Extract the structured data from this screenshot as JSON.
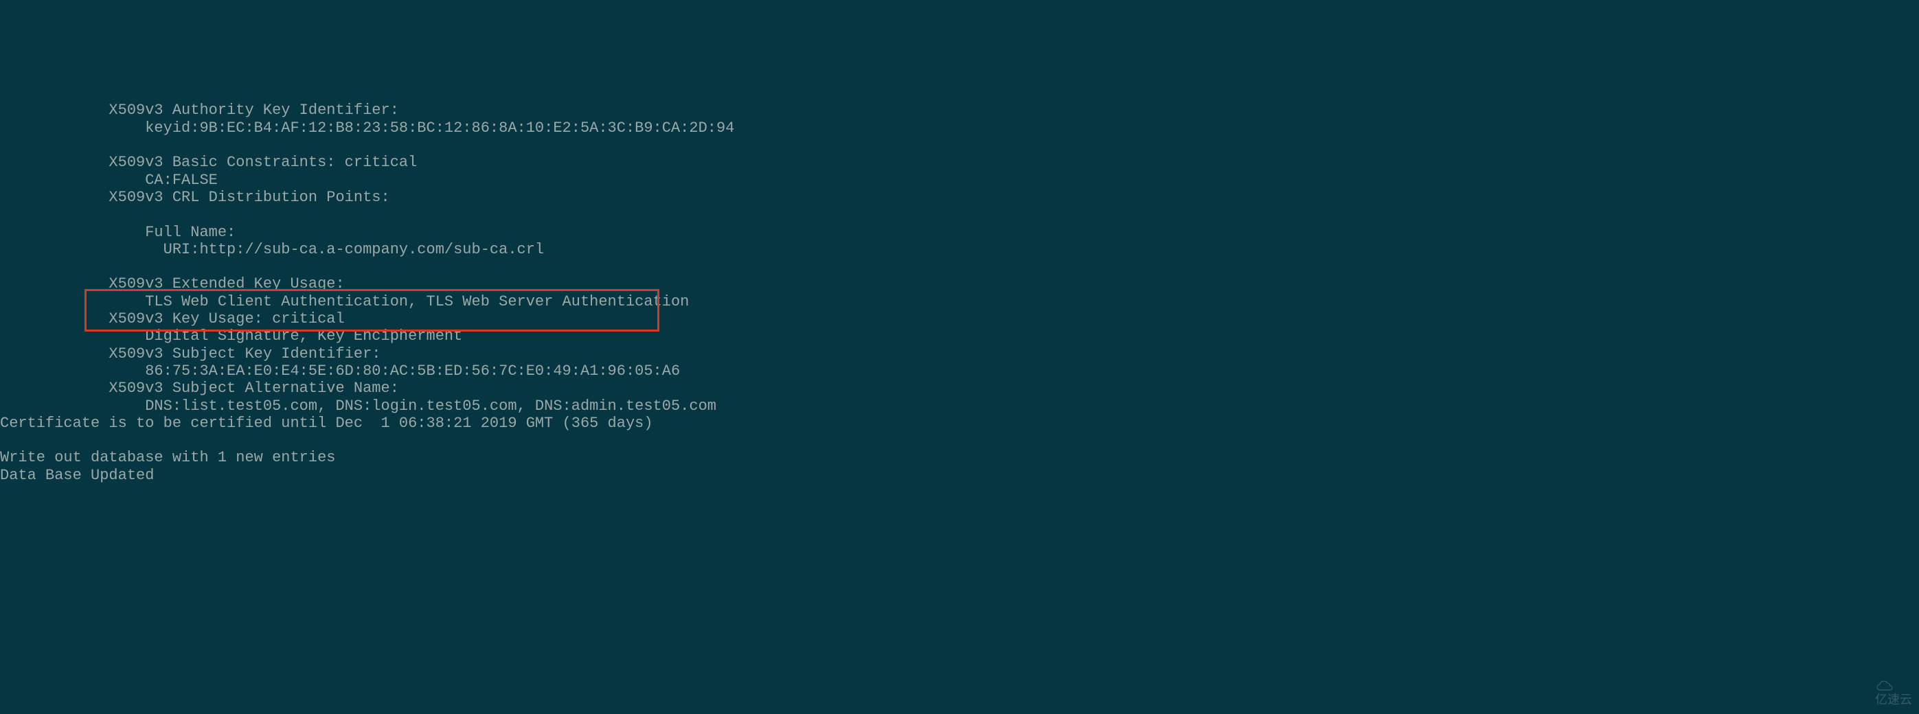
{
  "lines": {
    "l1": "            X509v3 Authority Key Identifier: ",
    "l2": "                keyid:9B:EC:B4:AF:12:B8:23:58:BC:12:86:8A:10:E2:5A:3C:B9:CA:2D:94",
    "l3": "",
    "l4": "            X509v3 Basic Constraints: critical",
    "l5": "                CA:FALSE",
    "l6": "            X509v3 CRL Distribution Points: ",
    "l7": "",
    "l8": "                Full Name:",
    "l9": "                  URI:http://sub-ca.a-company.com/sub-ca.crl",
    "l10": "",
    "l11": "            X509v3 Extended Key Usage: ",
    "l12": "                TLS Web Client Authentication, TLS Web Server Authentication",
    "l13": "            X509v3 Key Usage: critical",
    "l14": "                Digital Signature, Key Encipherment",
    "l15": "            X509v3 Subject Key Identifier: ",
    "l16": "                86:75:3A:EA:E0:E4:5E:6D:80:AC:5B:ED:56:7C:E0:49:A1:96:05:A6",
    "l17": "            X509v3 Subject Alternative Name: ",
    "l18": "                DNS:list.test05.com, DNS:login.test05.com, DNS:admin.test05.com",
    "l19": "Certificate is to be certified until Dec  1 06:38:21 2019 GMT (365 days)",
    "l20": "",
    "l21": "Write out database with 1 new entries",
    "l22": "Data Base Updated"
  },
  "watermark": {
    "text": "亿速云"
  }
}
